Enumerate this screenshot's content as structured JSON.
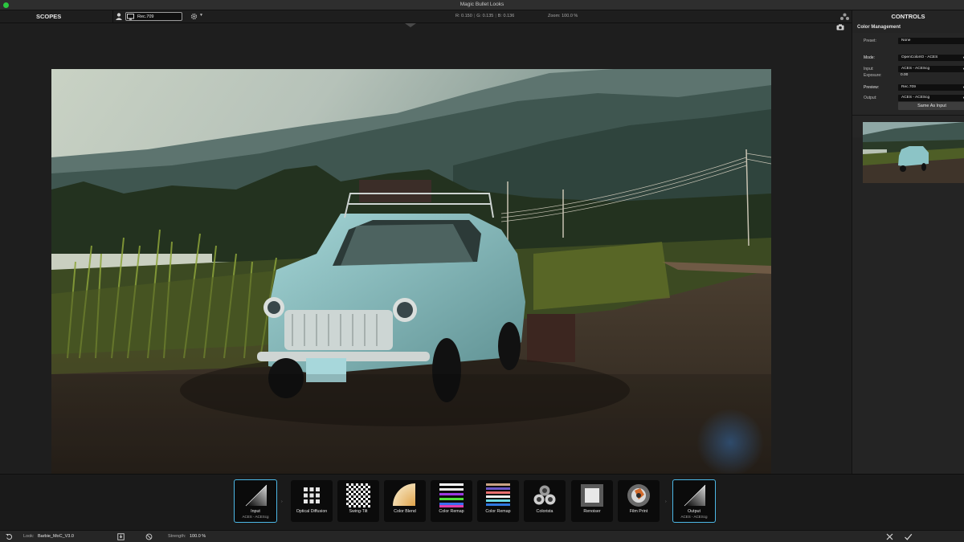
{
  "window": {
    "title": "Magic Bullet Looks"
  },
  "toolbar": {
    "scopes_label": "SCOPES",
    "colorspace_value": "Rec.709",
    "readout": {
      "r": "R: 0.150",
      "g": "G: 0.135",
      "b": "B: 0.136"
    },
    "zoom": "Zoom:  100.0 %"
  },
  "controls": {
    "title": "CONTROLS",
    "section": "Color Management",
    "preset_label": "Preset:",
    "preset_value": "None",
    "mode_label": "Mode:",
    "mode_value": "OpenColorIO - ACES",
    "input_label": "Input:",
    "input_value": "ACES - ACEScg",
    "exposure_label": "Exposure:",
    "exposure_value": "0.00",
    "preview_label": "Preview:",
    "preview_value": "Rec.709",
    "output_label": "Output:",
    "output_value": "ACES - ACEScg",
    "same_as_input": "Same As Input"
  },
  "chain": {
    "tools": [
      {
        "name": "Input",
        "sub": "ACES - ACEScg",
        "icon": "input-gradient-icon",
        "selected": true
      },
      {
        "name": "Optical Diffusion",
        "icon": "grid-dots-icon"
      },
      {
        "name": "Swing-Tilt",
        "icon": "checkerboard-icon"
      },
      {
        "name": "Color Blend",
        "icon": "color-blend-icon"
      },
      {
        "name": "Color Remap",
        "icon": "color-stripes-icon"
      },
      {
        "name": "Color Remap",
        "icon": "color-stripes-icon"
      },
      {
        "name": "Colorista",
        "icon": "colorista-wheels-icon"
      },
      {
        "name": "Renoiser",
        "icon": "renoiser-square-icon"
      },
      {
        "name": "Film Print",
        "icon": "film-reel-icon"
      },
      {
        "name": "Output",
        "sub": "ACES - ACEScg",
        "icon": "output-gradient-icon",
        "selected": true
      }
    ]
  },
  "bottom": {
    "look_label": "Look:",
    "look_name": "Barbie_MoC_V3.0",
    "strength_label": "Strength:",
    "strength_value": "100.0 %"
  },
  "colors": {
    "accent": "#4cb8e6",
    "background": "#1d1d1d"
  }
}
